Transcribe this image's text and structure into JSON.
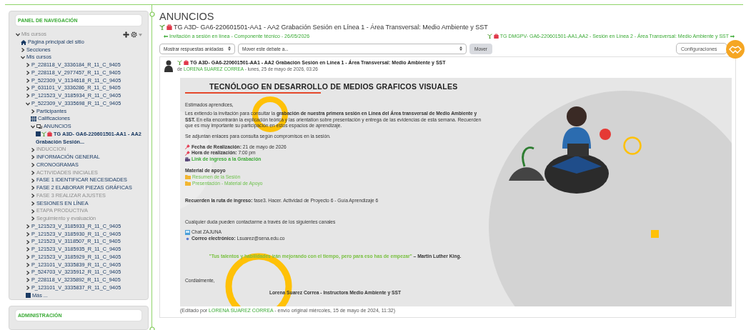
{
  "sidebar": {
    "title": "PANEL DE NAVEGACIÓN",
    "tree": [
      {
        "kind": "branch",
        "label": "Mis cursos",
        "expanded": true,
        "dimmed": true,
        "children": [
          {
            "kind": "home",
            "label": "Página principal del sitio"
          },
          {
            "kind": "branch",
            "label": "Secciones",
            "expanded": false,
            "dimmed": false
          },
          {
            "kind": "branch",
            "label": "Mis cursos",
            "expanded": true,
            "dimmed": false,
            "children": [
              {
                "kind": "branch",
                "label": "P_228118_V_3336184_R_11_C_9405",
                "expanded": false,
                "dimmed": false
              },
              {
                "kind": "branch",
                "label": "P_228118_V_2977457_R_11_C_9405",
                "expanded": false,
                "dimmed": false
              },
              {
                "kind": "branch",
                "label": "P_522309_V_3134618_R_11_C_9405",
                "expanded": false,
                "dimmed": false
              },
              {
                "kind": "branch",
                "label": "P_631101_V_3336286_R_11_C_9405",
                "expanded": false,
                "dimmed": false
              },
              {
                "kind": "branch",
                "label": "P_121523_V_3185934_R_11_C_9405",
                "expanded": false,
                "dimmed": false
              },
              {
                "kind": "branch",
                "label": "P_522309_V_3335698_R_11_C_9405",
                "expanded": true,
                "dimmed": false,
                "children": [
                  {
                    "kind": "branch",
                    "label": "Participantes",
                    "expanded": false,
                    "dimmed": false
                  },
                  {
                    "kind": "grades",
                    "label": "Calificaciones"
                  },
                  {
                    "kind": "forum",
                    "label": "ANUNCIOS",
                    "expanded": true,
                    "dimmed": false,
                    "children": [
                      {
                        "kind": "discussion",
                        "label": "TG A3D- GA6-220601501-AA1 - AA2 Grabación Sesión..."
                      }
                    ]
                  },
                  {
                    "kind": "branch",
                    "label": "INDUCCION",
                    "expanded": false,
                    "dimmed": true
                  },
                  {
                    "kind": "branch",
                    "label": "INFORMACIÓN GENERAL",
                    "expanded": false,
                    "dimmed": false
                  },
                  {
                    "kind": "branch",
                    "label": "CRONOGRAMAS",
                    "expanded": false,
                    "dimmed": false
                  },
                  {
                    "kind": "branch",
                    "label": "ACTIVIDADES INICIALES",
                    "expanded": false,
                    "dimmed": true
                  },
                  {
                    "kind": "branch",
                    "label": "FASE 1 IDENTIFICAR NECESIDADES",
                    "expanded": false,
                    "dimmed": false
                  },
                  {
                    "kind": "branch",
                    "label": "FASE 2 ELABORAR PIEZAS GRÁFICAS",
                    "expanded": false,
                    "dimmed": false
                  },
                  {
                    "kind": "branch",
                    "label": "FASE 3 REALIZAR AJUSTES",
                    "expanded": false,
                    "dimmed": true
                  },
                  {
                    "kind": "branch",
                    "label": "SESIONES EN LÍNEA",
                    "expanded": false,
                    "dimmed": false
                  },
                  {
                    "kind": "branch",
                    "label": "ETAPA PRODUCTIVA",
                    "expanded": false,
                    "dimmed": true
                  },
                  {
                    "kind": "branch",
                    "label": "Seguimiento y evaluación",
                    "expanded": false,
                    "dimmed": true
                  }
                ]
              },
              {
                "kind": "branch",
                "label": "P_121523_V_3185933_R_11_C_9405",
                "expanded": false,
                "dimmed": false
              },
              {
                "kind": "branch",
                "label": "P_121523_V_3185930_R_11_C_9405",
                "expanded": false,
                "dimmed": false
              },
              {
                "kind": "branch",
                "label": "P_121523_V_3118507_R_11_C_9405",
                "expanded": false,
                "dimmed": false
              },
              {
                "kind": "branch",
                "label": "P_121523_V_3185935_R_11_C_9405",
                "expanded": false,
                "dimmed": false
              },
              {
                "kind": "branch",
                "label": "P_121523_V_3185929_R_11_C_9405",
                "expanded": false,
                "dimmed": false
              },
              {
                "kind": "branch",
                "label": "P_123101_V_3335839_R_11_C_9405",
                "expanded": false,
                "dimmed": false
              },
              {
                "kind": "branch",
                "label": "P_524703_V_3235912_R_11_C_9405",
                "expanded": false,
                "dimmed": false
              },
              {
                "kind": "branch",
                "label": "P_228118_V_3235892_R_11_C_9405",
                "expanded": false,
                "dimmed": false
              },
              {
                "kind": "branch",
                "label": "P_123101_V_3335837_R_11_C_9405",
                "expanded": false,
                "dimmed": false
              },
              {
                "kind": "more",
                "label": "Más ..."
              }
            ]
          }
        ]
      }
    ]
  },
  "admin": {
    "title": "ADMINISTRACIÓN"
  },
  "page": {
    "title": "ANUNCIOS",
    "discussion_title": "TG A3D- GA6-220601501-AA1 - AA2 Grabación Sesión en Línea 1 - Área Transversal: Medio Ambiente y SST",
    "prev_link": "Invitación a sesión en línea - Componente técnico - 26/05/2026",
    "next_link": "TG DMGPV- GA6-220601501-AA1,AA2 - Sesión en Línea 2 - Área Transversal: Medio Ambiente y SST",
    "display_select": "Mostrar respuestas anidadas",
    "move_select": "Mover este debate a...",
    "move_button": "Mover",
    "settings_button": "Configuraciones"
  },
  "post": {
    "title": "TG A3D- GA6-220601501-AA1 - AA2 Grabación Sesión en Línea 1 - Área Transversal: Medio Ambiente y SST",
    "by": "de",
    "author": "LORENA SUAREZ CORREA",
    "date": "- lunes, 25 de mayo de 2026, 03:26",
    "content": {
      "heading": "TECNÓLOGO EN DESARROLLO DE MEDIOS GRAFICOS VISUALES",
      "greeting": "Estimados aprendices,",
      "intro": "Les extiendo la invitación para consultar la **grabación de nuestra primera sesión en Línea del Área transversal de Medio Ambiente y SST.** En ella encontrarán la explicación teórica y las orientation sobre presentación y entrega de las evidencias de esta semana. Recuerden que es muy importante su participación en estos espacios de aprendizaje.",
      "attach_note": "Se adjuntan enlaces para consulta según compromisos en la sesión.",
      "details": [
        {
          "kind": "pin",
          "text": "**Fecha de Realización:** 21 de mayo de 2026"
        },
        {
          "kind": "pin",
          "text": "**Hora de realización:** 7:00 pm"
        },
        {
          "kind": "video",
          "text": "Link de ingreso a la Grabación"
        }
      ],
      "material_title": "Material de apoyo",
      "materials": [
        "Resumen de la Sesión",
        "Presentación - Material de Apoyo"
      ],
      "route": "**Recuerden la ruta de ingreso:** fase3. Hacer.   Actividad de Proyecto 6 - Guía Aprendizaje 6",
      "contact_note": "Cualquier duda pueden contactarme a través de los siguientes canales",
      "channels": [
        {
          "kind": "chat",
          "text": "Chat ZAJUNA"
        },
        {
          "kind": "mail",
          "text": "**Correo electrónico:** Lsuarez@sena.edu.co"
        }
      ],
      "quote": "\"Tus talentos y habilidades irán mejorando con el tiempo, pero para eso has de empezar\"",
      "quote_author": "– Martin Luther King.",
      "closing": "Cordialmente,",
      "signature": "Lorena Suarez Correa - Instructora Medio Ambiente y SST"
    },
    "edited_prefix": "(Editado por",
    "edited_author": "LORENA SUAREZ CORREA",
    "edited_suffix": "- envío original miércoles, 15 de mayo de 2024, 11:32)"
  }
}
